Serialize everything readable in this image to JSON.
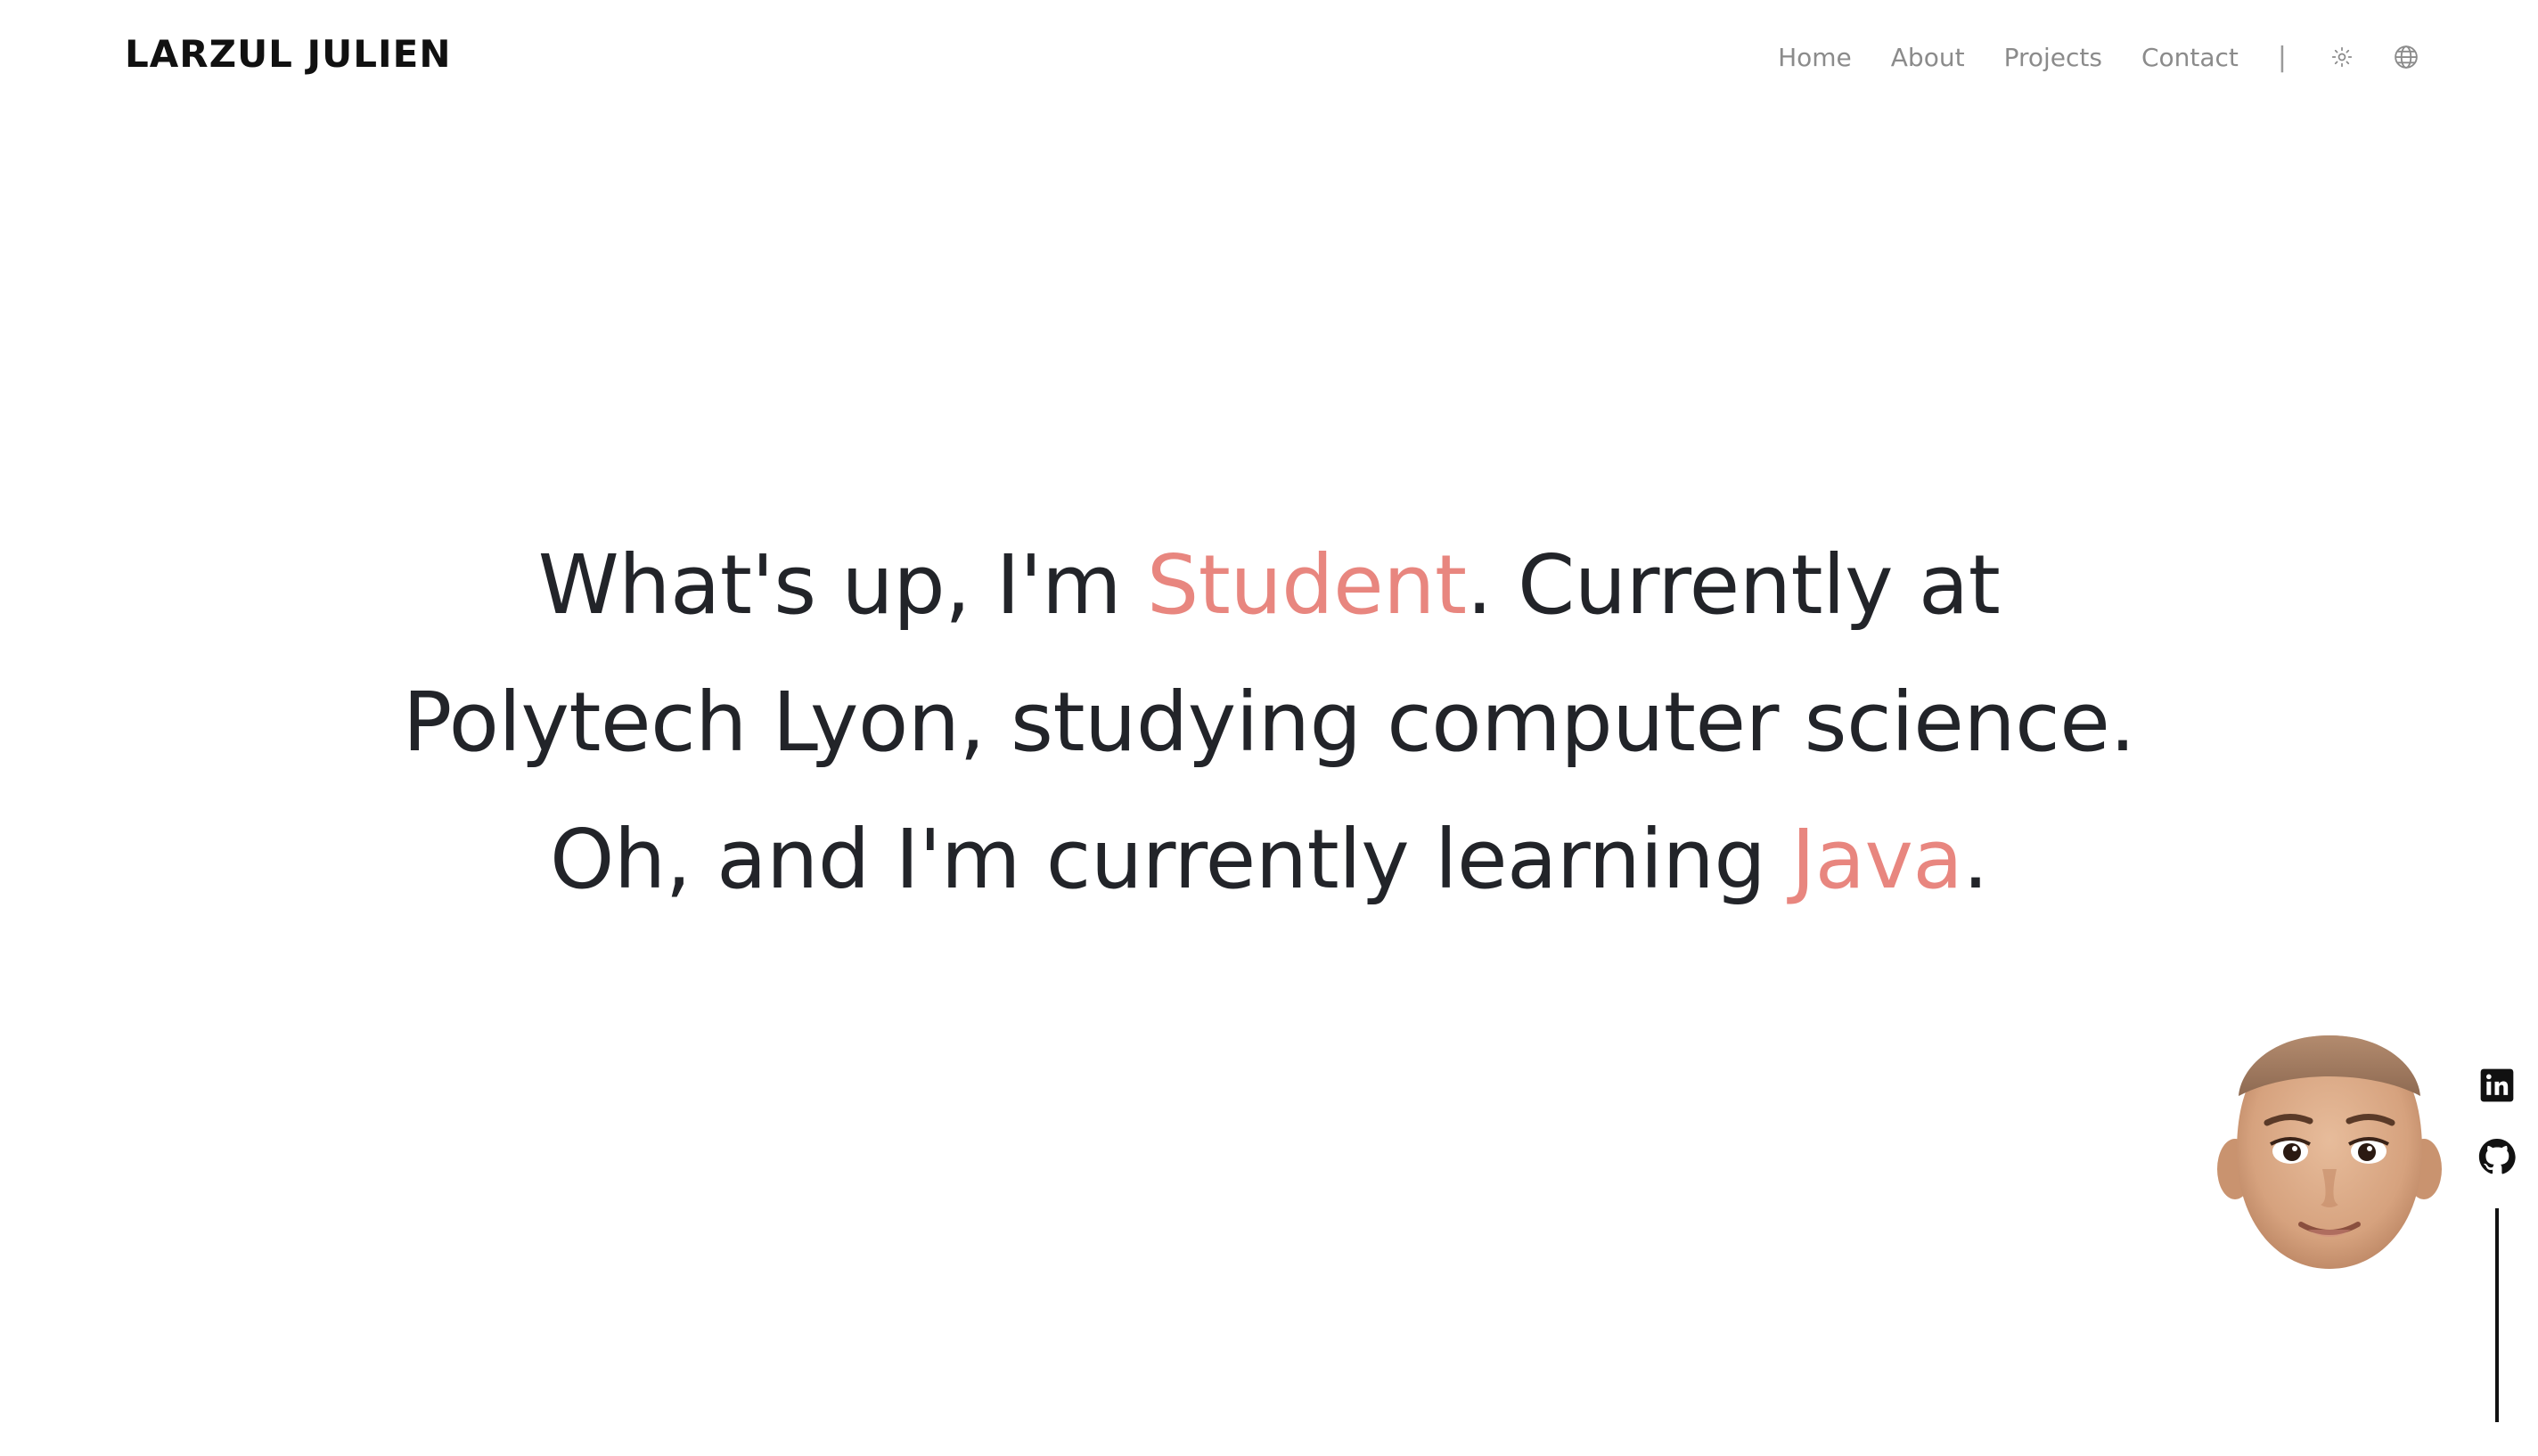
{
  "header": {
    "brand": "LARZUL JULIEN",
    "nav": [
      {
        "label": "Home"
      },
      {
        "label": "About"
      },
      {
        "label": "Projects"
      },
      {
        "label": "Contact"
      }
    ],
    "separator": "|",
    "icons": {
      "theme": "sun-icon",
      "language": "globe-icon"
    }
  },
  "hero": {
    "line1_a": "What's up, I'm ",
    "line1_accent": "Student",
    "line1_b": ". Currently at",
    "line2": "Polytech Lyon, studying computer science.",
    "line3_a": "Oh, and I'm currently learning ",
    "line3_accent": "Java",
    "line3_b": "."
  },
  "avatar": {
    "icon": "memoji-avatar"
  },
  "social": [
    {
      "name": "linkedin-icon"
    },
    {
      "name": "github-icon"
    }
  ],
  "colors": {
    "accent": "#e8867f",
    "text": "#222429",
    "nav": "#8b8b8b",
    "background": "#ffffff"
  }
}
